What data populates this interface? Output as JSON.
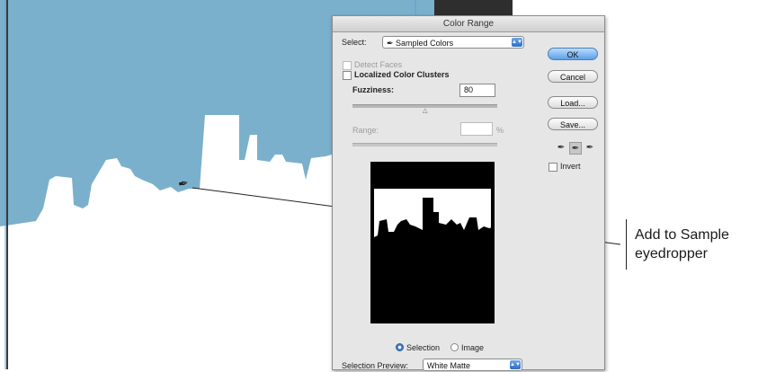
{
  "dialog": {
    "title": "Color Range",
    "select_label": "Select:",
    "select_value": "Sampled Colors",
    "select_icon": "eyedropper-icon",
    "detect_faces_label": "Detect Faces",
    "localized_label": "Localized Color Clusters",
    "fuzziness_label": "Fuzziness:",
    "fuzziness_value": "80",
    "range_label": "Range:",
    "range_unit": "%",
    "buttons": {
      "ok": "OK",
      "cancel": "Cancel",
      "load": "Load...",
      "save": "Save..."
    },
    "invert_label": "Invert",
    "radio_selection": "Selection",
    "radio_image": "Image",
    "preview_label": "Selection Preview:",
    "preview_value": "White Matte"
  },
  "callout": {
    "line1": "Add to Sample",
    "line2": "eyedropper"
  },
  "colors": {
    "sky": "#7ab0cc",
    "accent": "#3c7ed3"
  }
}
